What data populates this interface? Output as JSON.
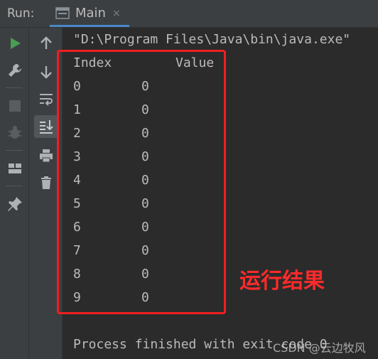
{
  "header": {
    "run_label": "Run:",
    "tab_label": "Main",
    "tab_close": "×"
  },
  "toolbar_primary": [
    {
      "name": "rerun-icon",
      "color": "#499c54"
    },
    {
      "name": "wrench-icon",
      "color": "#afb1b3"
    },
    {
      "name": "stop-icon",
      "color": "#5a5d5f"
    },
    {
      "name": "debug-bug-icon",
      "color": "#5a5d5f"
    },
    {
      "name": "layout-icon",
      "color": "#afb1b3"
    },
    {
      "name": "pin-icon",
      "color": "#afb1b3"
    }
  ],
  "toolbar_secondary": [
    {
      "name": "arrow-up-icon"
    },
    {
      "name": "arrow-down-icon"
    },
    {
      "name": "soft-wrap-icon"
    },
    {
      "name": "scroll-to-end-icon"
    },
    {
      "name": "print-icon"
    },
    {
      "name": "trash-icon"
    }
  ],
  "console": {
    "command": "\"D:\\Program Files\\Java\\bin\\java.exe\"",
    "header_index": "Index",
    "header_value": "Value",
    "rows": [
      {
        "index": "0",
        "value": "0"
      },
      {
        "index": "1",
        "value": "0"
      },
      {
        "index": "2",
        "value": "0"
      },
      {
        "index": "3",
        "value": "0"
      },
      {
        "index": "4",
        "value": "0"
      },
      {
        "index": "5",
        "value": "0"
      },
      {
        "index": "6",
        "value": "0"
      },
      {
        "index": "7",
        "value": "0"
      },
      {
        "index": "8",
        "value": "0"
      },
      {
        "index": "9",
        "value": "0"
      }
    ],
    "footer": "Process finished with exit code 0"
  },
  "annotation": "运行结果",
  "watermark": "CSDN @云边牧风",
  "colors": {
    "highlight": "#ee2020",
    "accent_tab": "#4a88c7"
  }
}
